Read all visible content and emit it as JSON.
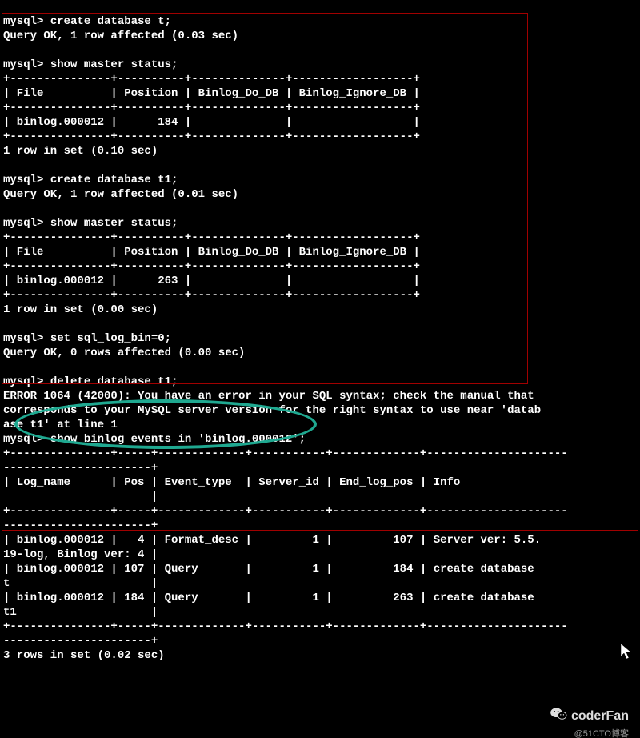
{
  "prompt": "mysql> ",
  "block1": {
    "cmd1": "create database t;",
    "res1": "Query OK, 1 row affected (0.03 sec)",
    "cmd2": "show master status;",
    "table1": {
      "sep_top": "+---------------+----------+--------------+------------------+",
      "header": "| File          | Position | Binlog_Do_DB | Binlog_Ignore_DB |",
      "sep_mid": "+---------------+----------+--------------+------------------+",
      "row": "| binlog.000012 |      184 |              |                  |",
      "sep_bot": "+---------------+----------+--------------+------------------+"
    },
    "res2": "1 row in set (0.10 sec)",
    "cmd3": "create database t1;",
    "res3": "Query OK, 1 row affected (0.01 sec)",
    "cmd4": "show master status;",
    "table2": {
      "sep_top": "+---------------+----------+--------------+------------------+",
      "header": "| File          | Position | Binlog_Do_DB | Binlog_Ignore_DB |",
      "sep_mid": "+---------------+----------+--------------+------------------+",
      "row": "| binlog.000012 |      263 |              |                  |",
      "sep_bot": "+---------------+----------+--------------+------------------+"
    },
    "res4": "1 row in set (0.00 sec)"
  },
  "block2": {
    "cmd1": "set sql_log_bin=0;",
    "res1": "Query OK, 0 rows affected (0.00 sec)",
    "cmd2": "delete database t1;",
    "err": "ERROR 1064 (42000): You have an error in your SQL syntax; check the manual that\ncorresponds to your MySQL server version for the right syntax to use near 'datab\nase t1' at line 1",
    "cmd3": "show binlog events in 'binlog.000012';",
    "table": {
      "sep_top": "+---------------+-----+-------------+-----------+-------------+---------------------\n----------------------+",
      "header": "| Log_name      | Pos | Event_type  | Server_id | End_log_pos | Info\n                      |",
      "sep_mid": "+---------------+-----+-------------+-----------+-------------+---------------------\n----------------------+",
      "row1": "| binlog.000012 |   4 | Format_desc |         1 |         107 | Server ver: 5.5.\n19-log, Binlog ver: 4 |",
      "row2": "| binlog.000012 | 107 | Query       |         1 |         184 | create database \nt                     |",
      "row3": "| binlog.000012 | 184 | Query       |         1 |         263 | create database \nt1                    |",
      "sep_bot": "+---------------+-----+-------------+-----------+-------------+---------------------\n----------------------+"
    },
    "res2": "3 rows in set (0.02 sec)"
  },
  "watermark": {
    "name": "coderFan",
    "sub": "@51CTO博客"
  }
}
